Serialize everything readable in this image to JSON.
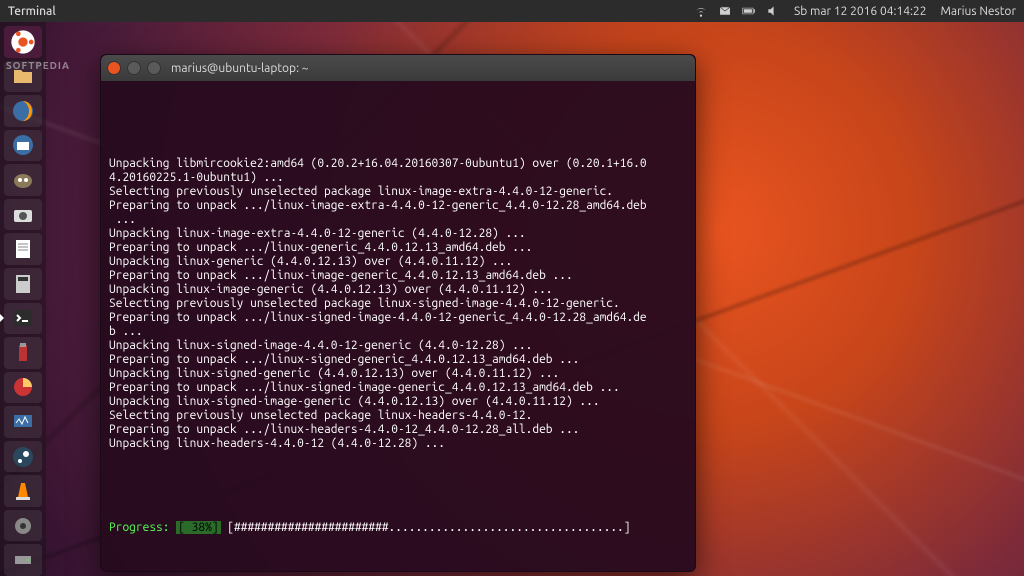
{
  "top_panel": {
    "app_title": "Terminal",
    "datetime": "Sb mar 12 2016   04:14:22",
    "user": "Marius Nestor"
  },
  "watermark": "SOFTPEDIA",
  "launcher": {
    "items": [
      {
        "name": "dash",
        "label": "Dash"
      },
      {
        "name": "files",
        "label": "Files"
      },
      {
        "name": "firefox",
        "label": "Firefox"
      },
      {
        "name": "thunderbird",
        "label": "Thunderbird"
      },
      {
        "name": "gimp",
        "label": "GIMP"
      },
      {
        "name": "screenshot",
        "label": "Screenshot"
      },
      {
        "name": "text-editor",
        "label": "Text Editor"
      },
      {
        "name": "calculator",
        "label": "Calculator"
      },
      {
        "name": "terminal",
        "label": "Terminal"
      },
      {
        "name": "usb-creator",
        "label": "Startup Disk Creator"
      },
      {
        "name": "usage",
        "label": "Disk Usage"
      },
      {
        "name": "system-monitor",
        "label": "System Monitor"
      },
      {
        "name": "steam",
        "label": "Steam"
      },
      {
        "name": "vlc",
        "label": "VLC"
      },
      {
        "name": "settings",
        "label": "System Settings"
      },
      {
        "name": "disks",
        "label": "Disks"
      }
    ]
  },
  "terminal": {
    "window_title": "marius@ubuntu-laptop: ~",
    "lines": [
      "Unpacking libmircookie2:amd64 (0.20.2+16.04.20160307-0ubuntu1) over (0.20.1+16.0",
      "4.20160225.1-0ubuntu1) ...",
      "Selecting previously unselected package linux-image-extra-4.4.0-12-generic.",
      "Preparing to unpack .../linux-image-extra-4.4.0-12-generic_4.4.0-12.28_amd64.deb",
      " ...",
      "Unpacking linux-image-extra-4.4.0-12-generic (4.4.0-12.28) ...",
      "Preparing to unpack .../linux-generic_4.4.0.12.13_amd64.deb ...",
      "Unpacking linux-generic (4.4.0.12.13) over (4.4.0.11.12) ...",
      "Preparing to unpack .../linux-image-generic_4.4.0.12.13_amd64.deb ...",
      "Unpacking linux-image-generic (4.4.0.12.13) over (4.4.0.11.12) ...",
      "Selecting previously unselected package linux-signed-image-4.4.0-12-generic.",
      "Preparing to unpack .../linux-signed-image-4.4.0-12-generic_4.4.0-12.28_amd64.de",
      "b ...",
      "Unpacking linux-signed-image-4.4.0-12-generic (4.4.0-12.28) ...",
      "Preparing to unpack .../linux-signed-generic_4.4.0.12.13_amd64.deb ...",
      "Unpacking linux-signed-generic (4.4.0.12.13) over (4.4.0.11.12) ...",
      "Preparing to unpack .../linux-signed-image-generic_4.4.0.12.13_amd64.deb ...",
      "Unpacking linux-signed-image-generic (4.4.0.12.13) over (4.4.0.11.12) ...",
      "Selecting previously unselected package linux-headers-4.4.0-12.",
      "Preparing to unpack .../linux-headers-4.4.0-12_4.4.0-12.28_all.deb ...",
      "Unpacking linux-headers-4.4.0-12 (4.4.0-12.28) ..."
    ],
    "progress": {
      "label": "Progress:",
      "percent_text": "[ 38%]",
      "bar": "[#######################...................................]"
    }
  }
}
